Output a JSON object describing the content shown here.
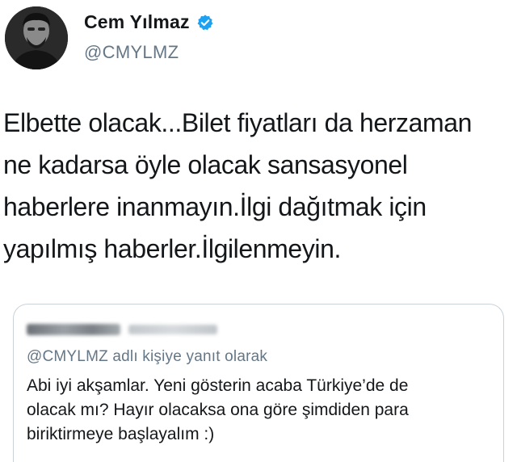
{
  "author": {
    "display_name": "Cem Yılmaz",
    "handle": "@CMYLMZ",
    "verified": true,
    "avatar_icon": "profile-photo-avatar",
    "verified_icon": "verified-badge-icon",
    "verified_color": "#1da1f2"
  },
  "tweet": {
    "lines": [
      "Elbette olacak...Bilet fiyatları da herzaman",
      "ne kadarsa öyle olacak sansasyonel",
      "haberlere inanmayın.İlgi dağıtmak için",
      "yapılmış haberler.İlgilenmeyin."
    ]
  },
  "quoted_tweet": {
    "author_blurred": true,
    "reply_context": "@CMYLMZ adlı kişiye yanıt olarak",
    "lines": [
      "Abi iyi akşamlar. Yeni gösterin acaba Türkiye’de de",
      "olacak mı? Hayır olacaksa ona göre şimdiden para",
      "biriktirmeye başlayalım :)"
    ]
  },
  "colors": {
    "text": "#14171a",
    "secondary": "#657786",
    "border": "#c9d2d9"
  }
}
